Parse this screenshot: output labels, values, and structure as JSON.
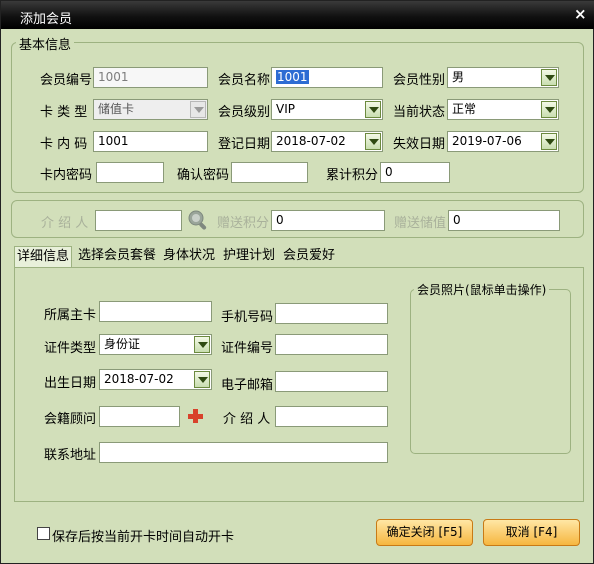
{
  "window": {
    "title": "添加会员",
    "close_label": "×"
  },
  "basic": {
    "legend": "基本信息",
    "member_no_label": "会员编号",
    "member_no_value": "1001",
    "member_name_label": "会员名称",
    "member_name_value": "1001",
    "gender_label": "会员性别",
    "gender_value": "男",
    "card_type_label": "卡 类 型",
    "card_type_value": "储值卡",
    "level_label": "会员级别",
    "level_value": "VIP",
    "status_label": "当前状态",
    "status_value": "正常",
    "card_code_label": "卡 内 码",
    "card_code_value": "1001",
    "reg_date_label": "登记日期",
    "reg_date_value": "2018-07-02",
    "expire_label": "失效日期",
    "expire_value": "2019-07-06",
    "card_pwd_label": "卡内密码",
    "card_pwd_value": "",
    "confirm_pwd_label": "确认密码",
    "confirm_pwd_value": "",
    "points_label": "累计积分",
    "points_value": "0"
  },
  "referral": {
    "referrer_label": "介 绍 人",
    "referrer_value": "",
    "gift_points_label": "赠送积分",
    "gift_points_value": "0",
    "gift_balance_label": "赠送储值",
    "gift_balance_value": "0"
  },
  "tabs": [
    {
      "label": "详细信息",
      "active": true
    },
    {
      "label": "选择会员套餐",
      "active": false
    },
    {
      "label": "身体状况",
      "active": false
    },
    {
      "label": "护理计划",
      "active": false
    },
    {
      "label": "会员爱好",
      "active": false
    }
  ],
  "detail": {
    "main_card_label": "所属主卡",
    "main_card_value": "",
    "phone_label": "手机号码",
    "phone_value": "",
    "id_type_label": "证件类型",
    "id_type_value": "身份证",
    "id_no_label": "证件编号",
    "id_no_value": "",
    "birth_label": "出生日期",
    "birth_value": "2018-07-02",
    "email_label": "电子邮箱",
    "email_value": "",
    "advisor_label": "会籍顾问",
    "advisor_value": "",
    "referrer_label": "介 绍 人",
    "referrer_value": "",
    "address_label": "联系地址",
    "address_value": "",
    "photo_legend": "会员照片(鼠标单击操作)"
  },
  "footer": {
    "auto_open_label": "保存后按当前开卡时间自动开卡",
    "auto_open_checked": false,
    "ok_label": "确定关闭 [F5]",
    "cancel_label": "取消 [F4]"
  },
  "colors": {
    "window_bg": "#d2dfba",
    "titlebar": "#000000",
    "button": "#f6b63f",
    "selection": "#2d6cd3"
  }
}
